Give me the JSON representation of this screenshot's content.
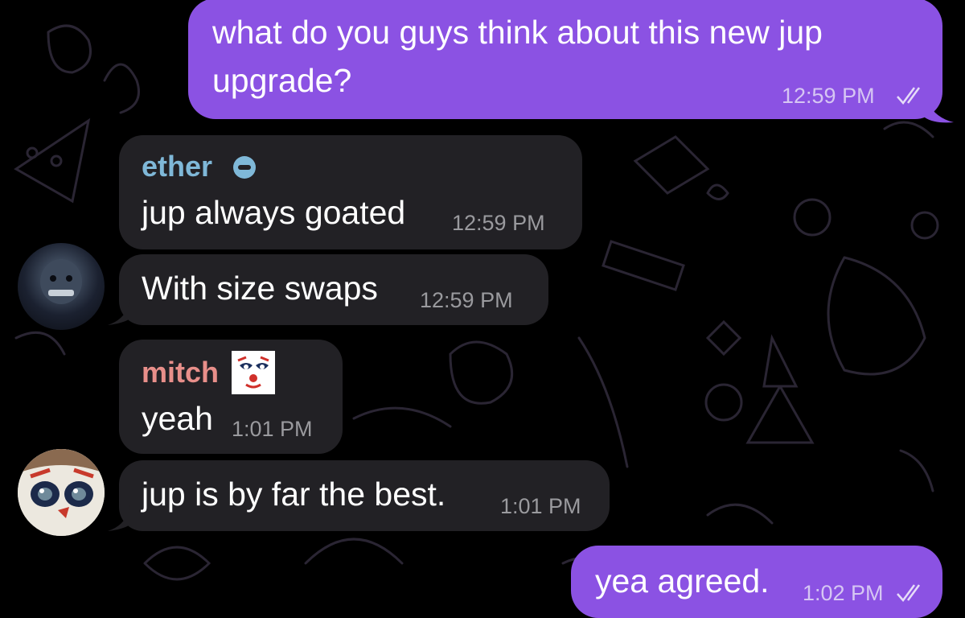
{
  "messages": [
    {
      "direction": "outgoing",
      "text_line1": "what do you guys think about this new jup",
      "text_line2": "upgrade?",
      "time": "12:59 PM",
      "status_icon": "double-check-icon"
    },
    {
      "direction": "incoming",
      "sender": "ether",
      "sender_badge_icon": "minus-circle-icon",
      "text": "jup always goated",
      "time": "12:59 PM"
    },
    {
      "direction": "incoming",
      "text": "With size swaps",
      "time": "12:59 PM",
      "avatar_icon": "dark-mask-avatar"
    },
    {
      "direction": "incoming",
      "sender": "mitch",
      "sender_badge_icon": "clown-face-emoji",
      "text": "yeah",
      "time": "1:01 PM"
    },
    {
      "direction": "incoming",
      "text": "jup is by far the best.",
      "time": "1:01 PM",
      "avatar_icon": "clown-face-avatar"
    },
    {
      "direction": "outgoing",
      "text": "yea agreed.",
      "time": "1:02 PM",
      "status_icon": "double-check-icon"
    }
  ],
  "colors": {
    "outgoing_bubble": "#8b52e3",
    "incoming_bubble": "#222125",
    "sender_ether": "#7fb8d8",
    "sender_mitch": "#e88f8a",
    "background": "#000000"
  }
}
